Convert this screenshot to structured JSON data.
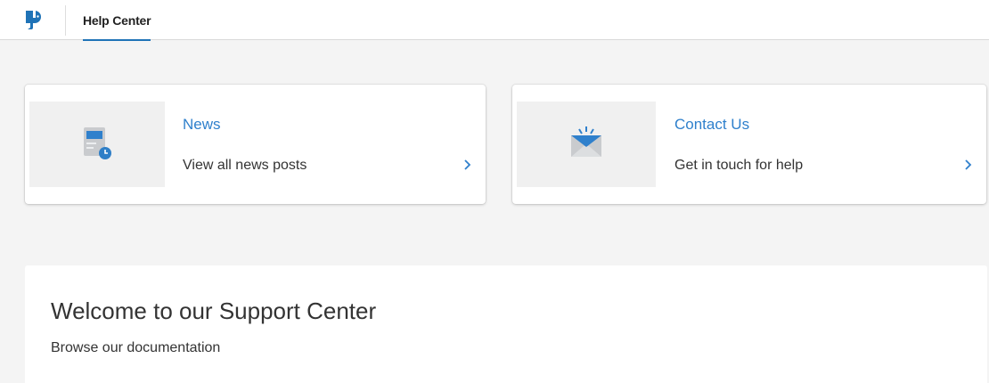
{
  "header": {
    "logo_icon": "brand-logo-icon",
    "tab_label": "Help Center",
    "accent_color": "#1f73b7"
  },
  "cards": [
    {
      "title": "News",
      "description": "View all news posts",
      "icon": "news-document-clock-icon",
      "chevron": "chevron-right-icon"
    },
    {
      "title": "Contact Us",
      "description": "Get in touch for help",
      "icon": "envelope-notification-icon",
      "chevron": "chevron-right-icon"
    }
  ],
  "welcome": {
    "heading": "Welcome to our Support Center",
    "subtext": "Browse our documentation"
  },
  "colors": {
    "link_blue": "#2f80cc",
    "background": "#f4f4f4"
  }
}
